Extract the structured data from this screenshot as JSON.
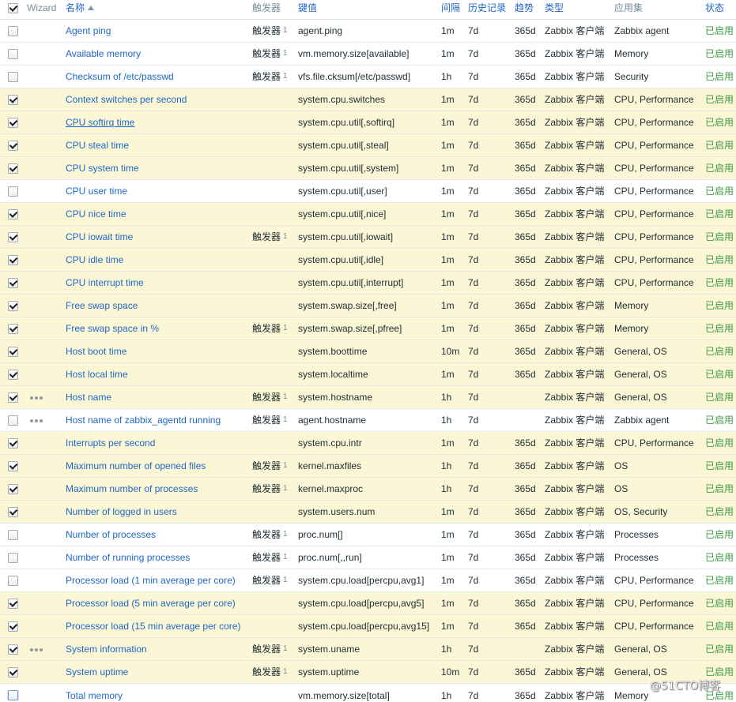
{
  "header": {
    "select_all_checked": true,
    "sort_icon": "sort-asc-icon",
    "columns": {
      "wizard": "Wizard",
      "name": "名称",
      "triggers": "触发器",
      "key": "键值",
      "interval": "间隔",
      "history": "历史记录",
      "trends": "趋势",
      "type": "类型",
      "applications": "应用集",
      "status": "状态"
    }
  },
  "labels": {
    "trigger_link": "触发器",
    "wizard_icon": "more-horizontal-icon"
  },
  "colors": {
    "selected_row_bg": "#fbf7d6",
    "link": "#1f67c4",
    "status_enabled": "#3c9a45",
    "header_text": "#768d99"
  },
  "rows": [
    {
      "checked": false,
      "wizard": false,
      "name": "Agent ping",
      "trigger_count": "1",
      "key": "agent.ping",
      "interval": "1m",
      "history": "7d",
      "trends": "365d",
      "type": "Zabbix 客户端",
      "applications": "Zabbix agent",
      "status": "已启用"
    },
    {
      "checked": false,
      "wizard": false,
      "name": "Available memory",
      "trigger_count": "1",
      "key": "vm.memory.size[available]",
      "interval": "1m",
      "history": "7d",
      "trends": "365d",
      "type": "Zabbix 客户端",
      "applications": "Memory",
      "status": "已启用"
    },
    {
      "checked": false,
      "wizard": false,
      "name": "Checksum of /etc/passwd",
      "trigger_count": "1",
      "key": "vfs.file.cksum[/etc/passwd]",
      "interval": "1h",
      "history": "7d",
      "trends": "365d",
      "type": "Zabbix 客户端",
      "applications": "Security",
      "status": "已启用"
    },
    {
      "checked": true,
      "wizard": false,
      "name": "Context switches per second",
      "trigger_count": "",
      "key": "system.cpu.switches",
      "interval": "1m",
      "history": "7d",
      "trends": "365d",
      "type": "Zabbix 客户端",
      "applications": "CPU, Performance",
      "status": "已启用"
    },
    {
      "checked": true,
      "wizard": false,
      "hovered": true,
      "name": "CPU softirq time",
      "trigger_count": "",
      "key": "system.cpu.util[,softirq]",
      "interval": "1m",
      "history": "7d",
      "trends": "365d",
      "type": "Zabbix 客户端",
      "applications": "CPU, Performance",
      "status": "已启用"
    },
    {
      "checked": true,
      "wizard": false,
      "name": "CPU steal time",
      "trigger_count": "",
      "key": "system.cpu.util[,steal]",
      "interval": "1m",
      "history": "7d",
      "trends": "365d",
      "type": "Zabbix 客户端",
      "applications": "CPU, Performance",
      "status": "已启用"
    },
    {
      "checked": true,
      "wizard": false,
      "name": "CPU system time",
      "trigger_count": "",
      "key": "system.cpu.util[,system]",
      "interval": "1m",
      "history": "7d",
      "trends": "365d",
      "type": "Zabbix 客户端",
      "applications": "CPU, Performance",
      "status": "已启用"
    },
    {
      "checked": false,
      "wizard": false,
      "name": "CPU user time",
      "trigger_count": "",
      "key": "system.cpu.util[,user]",
      "interval": "1m",
      "history": "7d",
      "trends": "365d",
      "type": "Zabbix 客户端",
      "applications": "CPU, Performance",
      "status": "已启用"
    },
    {
      "checked": true,
      "wizard": false,
      "name": "CPU nice time",
      "trigger_count": "",
      "key": "system.cpu.util[,nice]",
      "interval": "1m",
      "history": "7d",
      "trends": "365d",
      "type": "Zabbix 客户端",
      "applications": "CPU, Performance",
      "status": "已启用"
    },
    {
      "checked": true,
      "wizard": false,
      "name": "CPU iowait time",
      "trigger_count": "1",
      "key": "system.cpu.util[,iowait]",
      "interval": "1m",
      "history": "7d",
      "trends": "365d",
      "type": "Zabbix 客户端",
      "applications": "CPU, Performance",
      "status": "已启用"
    },
    {
      "checked": true,
      "wizard": false,
      "name": "CPU idle time",
      "trigger_count": "",
      "key": "system.cpu.util[,idle]",
      "interval": "1m",
      "history": "7d",
      "trends": "365d",
      "type": "Zabbix 客户端",
      "applications": "CPU, Performance",
      "status": "已启用"
    },
    {
      "checked": true,
      "wizard": false,
      "name": "CPU interrupt time",
      "trigger_count": "",
      "key": "system.cpu.util[,interrupt]",
      "interval": "1m",
      "history": "7d",
      "trends": "365d",
      "type": "Zabbix 客户端",
      "applications": "CPU, Performance",
      "status": "已启用"
    },
    {
      "checked": true,
      "wizard": false,
      "name": "Free swap space",
      "trigger_count": "",
      "key": "system.swap.size[,free]",
      "interval": "1m",
      "history": "7d",
      "trends": "365d",
      "type": "Zabbix 客户端",
      "applications": "Memory",
      "status": "已启用"
    },
    {
      "checked": true,
      "wizard": false,
      "name": "Free swap space in %",
      "trigger_count": "1",
      "key": "system.swap.size[,pfree]",
      "interval": "1m",
      "history": "7d",
      "trends": "365d",
      "type": "Zabbix 客户端",
      "applications": "Memory",
      "status": "已启用"
    },
    {
      "checked": true,
      "wizard": false,
      "name": "Host boot time",
      "trigger_count": "",
      "key": "system.boottime",
      "interval": "10m",
      "history": "7d",
      "trends": "365d",
      "type": "Zabbix 客户端",
      "applications": "General, OS",
      "status": "已启用"
    },
    {
      "checked": true,
      "wizard": false,
      "name": "Host local time",
      "trigger_count": "",
      "key": "system.localtime",
      "interval": "1m",
      "history": "7d",
      "trends": "365d",
      "type": "Zabbix 客户端",
      "applications": "General, OS",
      "status": "已启用"
    },
    {
      "checked": true,
      "wizard": true,
      "name": "Host name",
      "trigger_count": "1",
      "key": "system.hostname",
      "interval": "1h",
      "history": "7d",
      "trends": "",
      "type": "Zabbix 客户端",
      "applications": "General, OS",
      "status": "已启用"
    },
    {
      "checked": false,
      "wizard": true,
      "name": "Host name of zabbix_agentd running",
      "trigger_count": "1",
      "key": "agent.hostname",
      "interval": "1h",
      "history": "7d",
      "trends": "",
      "type": "Zabbix 客户端",
      "applications": "Zabbix agent",
      "status": "已启用"
    },
    {
      "checked": true,
      "wizard": false,
      "name": "Interrupts per second",
      "trigger_count": "",
      "key": "system.cpu.intr",
      "interval": "1m",
      "history": "7d",
      "trends": "365d",
      "type": "Zabbix 客户端",
      "applications": "CPU, Performance",
      "status": "已启用"
    },
    {
      "checked": true,
      "wizard": false,
      "name": "Maximum number of opened files",
      "trigger_count": "1",
      "key": "kernel.maxfiles",
      "interval": "1h",
      "history": "7d",
      "trends": "365d",
      "type": "Zabbix 客户端",
      "applications": "OS",
      "status": "已启用"
    },
    {
      "checked": true,
      "wizard": false,
      "name": "Maximum number of processes",
      "trigger_count": "1",
      "key": "kernel.maxproc",
      "interval": "1h",
      "history": "7d",
      "trends": "365d",
      "type": "Zabbix 客户端",
      "applications": "OS",
      "status": "已启用"
    },
    {
      "checked": true,
      "wizard": false,
      "name": "Number of logged in users",
      "trigger_count": "",
      "key": "system.users.num",
      "interval": "1m",
      "history": "7d",
      "trends": "365d",
      "type": "Zabbix 客户端",
      "applications": "OS, Security",
      "status": "已启用"
    },
    {
      "checked": false,
      "wizard": false,
      "name": "Number of processes",
      "trigger_count": "1",
      "key": "proc.num[]",
      "interval": "1m",
      "history": "7d",
      "trends": "365d",
      "type": "Zabbix 客户端",
      "applications": "Processes",
      "status": "已启用"
    },
    {
      "checked": false,
      "wizard": false,
      "name": "Number of running processes",
      "trigger_count": "1",
      "key": "proc.num[,,run]",
      "interval": "1m",
      "history": "7d",
      "trends": "365d",
      "type": "Zabbix 客户端",
      "applications": "Processes",
      "status": "已启用"
    },
    {
      "checked": false,
      "wizard": false,
      "name": "Processor load (1 min average per core)",
      "trigger_count": "1",
      "key": "system.cpu.load[percpu,avg1]",
      "interval": "1m",
      "history": "7d",
      "trends": "365d",
      "type": "Zabbix 客户端",
      "applications": "CPU, Performance",
      "status": "已启用"
    },
    {
      "checked": true,
      "wizard": false,
      "name": "Processor load (5 min average per core)",
      "trigger_count": "",
      "key": "system.cpu.load[percpu,avg5]",
      "interval": "1m",
      "history": "7d",
      "trends": "365d",
      "type": "Zabbix 客户端",
      "applications": "CPU, Performance",
      "status": "已启用"
    },
    {
      "checked": true,
      "wizard": false,
      "name": "Processor load (15 min average per core)",
      "trigger_count": "",
      "key": "system.cpu.load[percpu,avg15]",
      "interval": "1m",
      "history": "7d",
      "trends": "365d",
      "type": "Zabbix 客户端",
      "applications": "CPU, Performance",
      "status": "已启用"
    },
    {
      "checked": true,
      "wizard": true,
      "name": "System information",
      "trigger_count": "1",
      "key": "system.uname",
      "interval": "1h",
      "history": "7d",
      "trends": "",
      "type": "Zabbix 客户端",
      "applications": "General, OS",
      "status": "已启用"
    },
    {
      "checked": true,
      "wizard": false,
      "name": "System uptime",
      "trigger_count": "1",
      "key": "system.uptime",
      "interval": "10m",
      "history": "7d",
      "trends": "365d",
      "type": "Zabbix 客户端",
      "applications": "General, OS",
      "status": "已启用"
    },
    {
      "checked": false,
      "wizard": false,
      "focused": true,
      "name": "Total memory",
      "trigger_count": "",
      "key": "vm.memory.size[total]",
      "interval": "1h",
      "history": "7d",
      "trends": "365d",
      "type": "Zabbix 客户端",
      "applications": "Memory",
      "status": "已启用"
    }
  ],
  "watermark": "@51CTO博客"
}
